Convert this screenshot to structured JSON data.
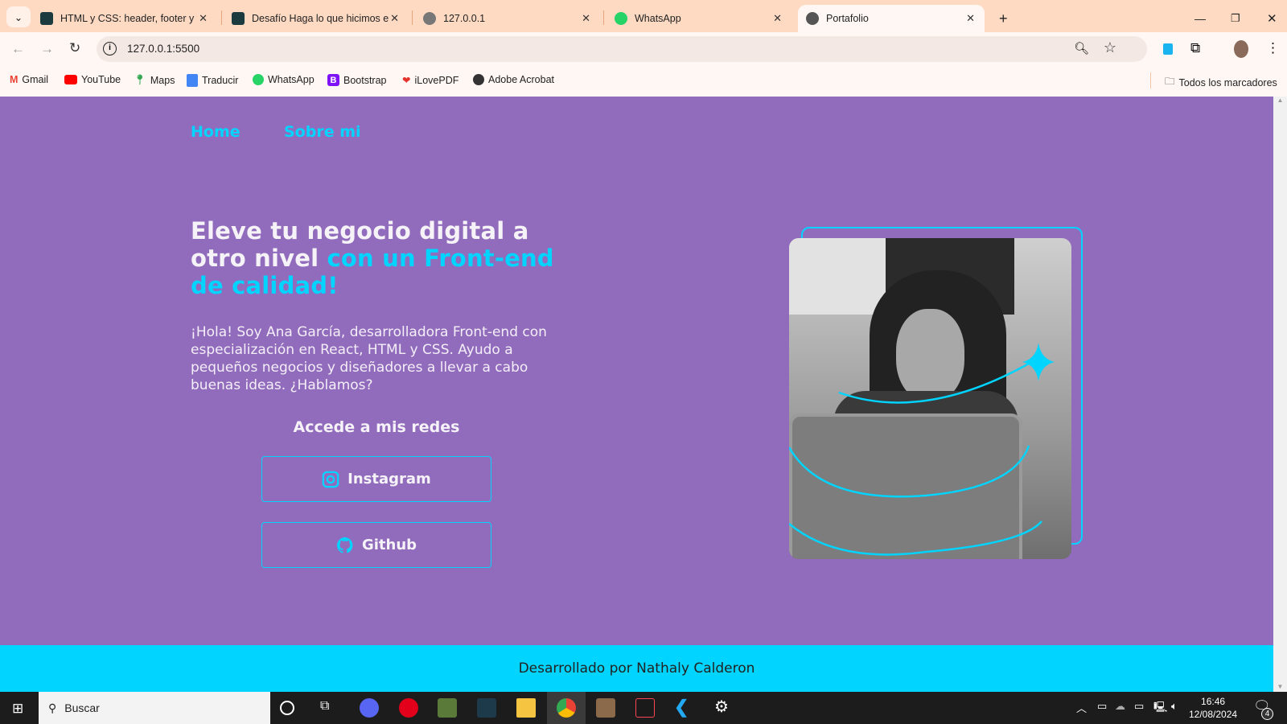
{
  "browser": {
    "tabs": [
      {
        "title": "HTML y CSS: header, footer y va",
        "icon": "alura-icon"
      },
      {
        "title": "Desafío Haga lo que hicimos en",
        "icon": "alura-icon"
      },
      {
        "title": "127.0.0.1",
        "icon": "globe-icon"
      },
      {
        "title": "WhatsApp",
        "icon": "whatsapp-icon"
      },
      {
        "title": "Portafolio",
        "icon": "globe-icon",
        "active": true
      }
    ],
    "url": "127.0.0.1:5500",
    "bookmarks": [
      "Gmail",
      "YouTube",
      "Maps",
      "Traducir",
      "WhatsApp",
      "Bootstrap",
      "iLovePDF",
      "Adobe Acrobat"
    ],
    "all_bookmarks": "Todos los marcadores"
  },
  "page": {
    "nav": [
      "Home",
      "Sobre mi"
    ],
    "headline_white": "Eleve tu negocio digital a otro nivel ",
    "headline_accent": "con un Front-end de calidad!",
    "intro": "¡Hola! Soy Ana García, desarrolladora Front-end con especialización en React, HTML y CSS. Ayudo a pequeños negocios y diseñadores a llevar a cabo buenas ideas. ¿Hablamos?",
    "redes_title": "Accede a mis redes",
    "buttons": [
      {
        "label": "Instagram",
        "icon": "instagram-icon"
      },
      {
        "label": "Github",
        "icon": "github-icon"
      }
    ],
    "footer": "Desarrollado por Nathaly Calderon"
  },
  "taskbar": {
    "search": "Buscar",
    "time": "16:46",
    "date": "12/08/2024",
    "notifications": "4"
  },
  "colors": {
    "accent": "#00d4ff",
    "background": "#926cbc",
    "tabbar": "#fedac3"
  }
}
